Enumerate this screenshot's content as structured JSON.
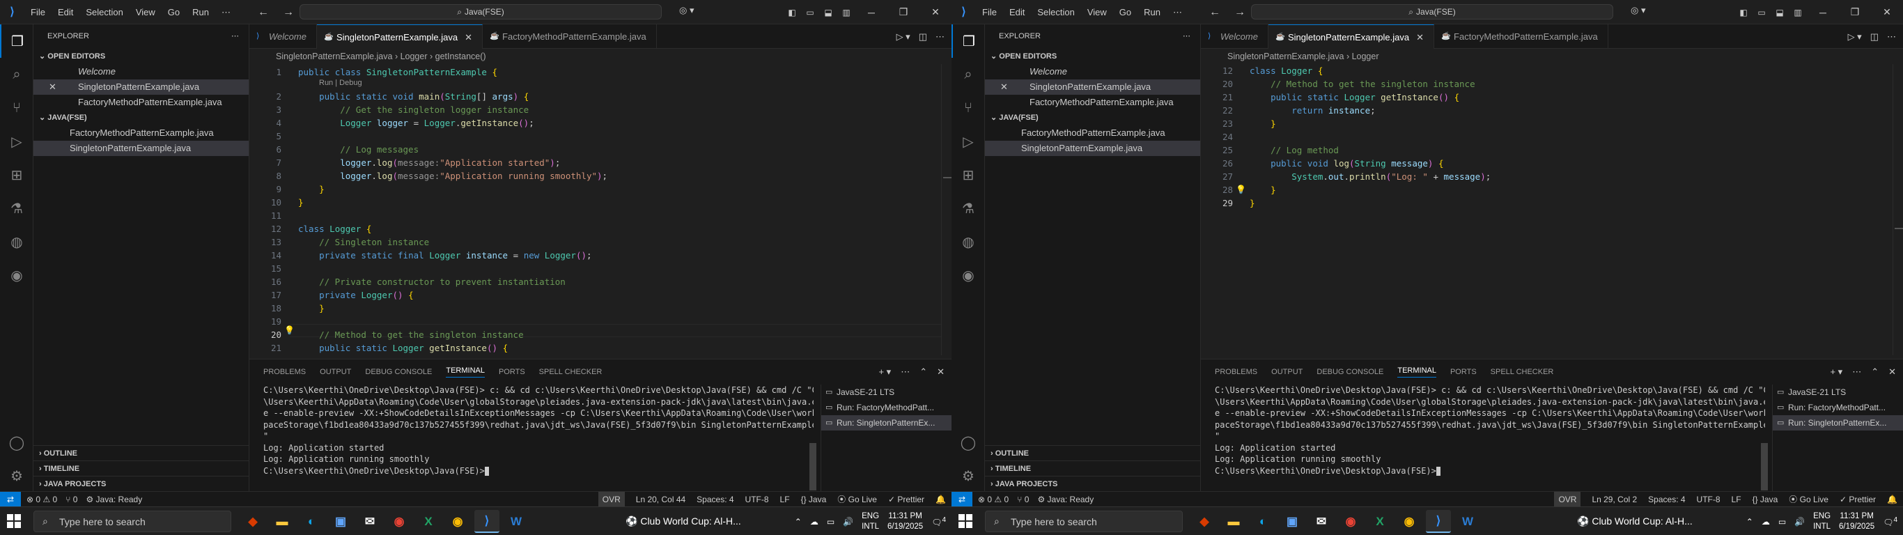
{
  "screens": [
    {
      "title": {
        "menu": [
          "File",
          "Edit",
          "Selection",
          "View",
          "Go",
          "Run"
        ],
        "search": "Java(FSE)"
      },
      "sidebar": {
        "title": "EXPLORER",
        "open_editors": "OPEN EDITORS",
        "open_items": [
          "Welcome",
          "SingletonPatternExample.java",
          "FactoryMethodPatternExample.java"
        ],
        "folder": "JAVA(FSE)",
        "folder_items": [
          "FactoryMethodPatternExample.java",
          "SingletonPatternExample.java"
        ],
        "outline": "OUTLINE",
        "timeline": "TIMELINE",
        "java_projects": "JAVA PROJECTS"
      },
      "tabs": [
        "Welcome",
        "SingletonPatternExample.java",
        "FactoryMethodPatternExample.java"
      ],
      "breadcrumb": [
        "SingletonPatternExample.java",
        "Logger",
        "getInstance()"
      ],
      "code": {
        "codelens": "Run | Debug",
        "lines": [
          {
            "n": "1",
            "t": "public class SingletonPatternExample {"
          },
          {
            "n": "2",
            "t": "    public static void main(String[] args) {"
          },
          {
            "n": "3",
            "t": "        // Get the singleton logger instance"
          },
          {
            "n": "4",
            "t": "        Logger logger = Logger.getInstance();"
          },
          {
            "n": "5",
            "t": ""
          },
          {
            "n": "6",
            "t": "        // Log messages"
          },
          {
            "n": "7",
            "t": "        logger.log(message:\"Application started\");"
          },
          {
            "n": "8",
            "t": "        logger.log(message:\"Application running smoothly\");"
          },
          {
            "n": "9",
            "t": "    }"
          },
          {
            "n": "10",
            "t": "}"
          },
          {
            "n": "11",
            "t": ""
          },
          {
            "n": "12",
            "t": "class Logger {"
          },
          {
            "n": "13",
            "t": "    // Singleton instance"
          },
          {
            "n": "14",
            "t": "    private static final Logger instance = new Logger();"
          },
          {
            "n": "15",
            "t": ""
          },
          {
            "n": "16",
            "t": "    // Private constructor to prevent instantiation"
          },
          {
            "n": "17",
            "t": "    private Logger() {"
          },
          {
            "n": "18",
            "t": "    }"
          },
          {
            "n": "19",
            "t": ""
          },
          {
            "n": "20",
            "t": "    // Method to get the singleton instance"
          },
          {
            "n": "21",
            "t": "    public static Logger getInstance() {"
          }
        ]
      },
      "panel": {
        "tabs": [
          "PROBLEMS",
          "OUTPUT",
          "DEBUG CONSOLE",
          "TERMINAL",
          "PORTS",
          "SPELL CHECKER"
        ],
        "terminal_lines": [
          "C:\\Users\\Keerthi\\OneDrive\\Desktop\\Java(FSE)> c: && cd c:\\Users\\Keerthi\\OneDrive\\Desktop\\Java(FSE) && cmd /C \"C:",
          "\\Users\\Keerthi\\AppData\\Roaming\\Code\\User\\globalStorage\\pleiades.java-extension-pack-jdk\\java\\latest\\bin\\java.ex",
          "e --enable-preview -XX:+ShowCodeDetailsInExceptionMessages -cp C:\\Users\\Keerthi\\AppData\\Roaming\\Code\\User\\works",
          "paceStorage\\f1bd1ea80433a9d70c137b527455f399\\redhat.java\\jdt_ws\\Java(FSE)_5f3d07f9\\bin SingletonPatternExample",
          "\"",
          "Log: Application started",
          "Log: Application running smoothly",
          "",
          "C:\\Users\\Keerthi\\OneDrive\\Desktop\\Java(FSE)>"
        ],
        "terminals": [
          "JavaSE-21 LTS",
          "Run: FactoryMethodPatt...",
          "Run: SingletonPatternEx..."
        ]
      },
      "status": {
        "errors": "0",
        "warnings": "0",
        "ports": "0",
        "java": "Java: Ready",
        "ovr": "OVR",
        "cursor": "Ln 20, Col 44",
        "spaces": "Spaces: 4",
        "encoding": "UTF-8",
        "eol": "LF",
        "lang": "{} Java",
        "golive": "Go Live",
        "prettier": "Prettier"
      }
    },
    {
      "title": {
        "menu": [
          "File",
          "Edit",
          "Selection",
          "View",
          "Go",
          "Run"
        ],
        "search": "Java(FSE)"
      },
      "sidebar": {
        "title": "EXPLORER",
        "open_editors": "OPEN EDITORS",
        "open_items": [
          "Welcome",
          "SingletonPatternExample.java",
          "FactoryMethodPatternExample.java"
        ],
        "folder": "JAVA(FSE)",
        "folder_items": [
          "FactoryMethodPatternExample.java",
          "SingletonPatternExample.java"
        ],
        "outline": "OUTLINE",
        "timeline": "TIMELINE",
        "java_projects": "JAVA PROJECTS"
      },
      "tabs": [
        "Welcome",
        "SingletonPatternExample.java",
        "FactoryMethodPatternExample.java"
      ],
      "breadcrumb": [
        "SingletonPatternExample.java",
        "Logger"
      ],
      "code": {
        "lines": [
          {
            "n": "12",
            "t": "class Logger {"
          },
          {
            "n": "20",
            "t": "    // Method to get the singleton instance"
          },
          {
            "n": "21",
            "t": "    public static Logger getInstance() {"
          },
          {
            "n": "22",
            "t": "        return instance;"
          },
          {
            "n": "23",
            "t": "    }"
          },
          {
            "n": "24",
            "t": ""
          },
          {
            "n": "25",
            "t": "    // Log method"
          },
          {
            "n": "26",
            "t": "    public void log(String message) {"
          },
          {
            "n": "27",
            "t": "        System.out.println(\"Log: \" + message);"
          },
          {
            "n": "28",
            "t": "    }"
          },
          {
            "n": "29",
            "t": "}"
          }
        ]
      },
      "panel": {
        "tabs": [
          "PROBLEMS",
          "OUTPUT",
          "DEBUG CONSOLE",
          "TERMINAL",
          "PORTS",
          "SPELL CHECKER"
        ],
        "terminal_lines": [
          "C:\\Users\\Keerthi\\OneDrive\\Desktop\\Java(FSE)> c: && cd c:\\Users\\Keerthi\\OneDrive\\Desktop\\Java(FSE) && cmd /C \"C:",
          "\\Users\\Keerthi\\AppData\\Roaming\\Code\\User\\globalStorage\\pleiades.java-extension-pack-jdk\\java\\latest\\bin\\java.ex",
          "e --enable-preview -XX:+ShowCodeDetailsInExceptionMessages -cp C:\\Users\\Keerthi\\AppData\\Roaming\\Code\\User\\works",
          "paceStorage\\f1bd1ea80433a9d70c137b527455f399\\redhat.java\\jdt_ws\\Java(FSE)_5f3d07f9\\bin SingletonPatternExample",
          "\"",
          "Log: Application started",
          "Log: Application running smoothly",
          "",
          "C:\\Users\\Keerthi\\OneDrive\\Desktop\\Java(FSE)>"
        ],
        "terminals": [
          "JavaSE-21 LTS",
          "Run: FactoryMethodPatt...",
          "Run: SingletonPatternEx..."
        ]
      },
      "status": {
        "errors": "0",
        "warnings": "0",
        "ports": "0",
        "java": "Java: Ready",
        "ovr": "OVR",
        "cursor": "Ln 29, Col 2",
        "spaces": "Spaces: 4",
        "encoding": "UTF-8",
        "eol": "LF",
        "lang": "{} Java",
        "golive": "Go Live",
        "prettier": "Prettier"
      }
    }
  ],
  "taskbar": {
    "search_placeholder": "Type here to search",
    "news": "Club World Cup: Al-H...",
    "lang_top": "ENG",
    "lang_bottom": "INTL",
    "time": "11:31 PM",
    "date": "6/19/2025",
    "notif_count": "4"
  },
  "colors": {
    "accent": "#0078d4",
    "bg": "#1f1f1f",
    "sidebar_bg": "#181818"
  }
}
